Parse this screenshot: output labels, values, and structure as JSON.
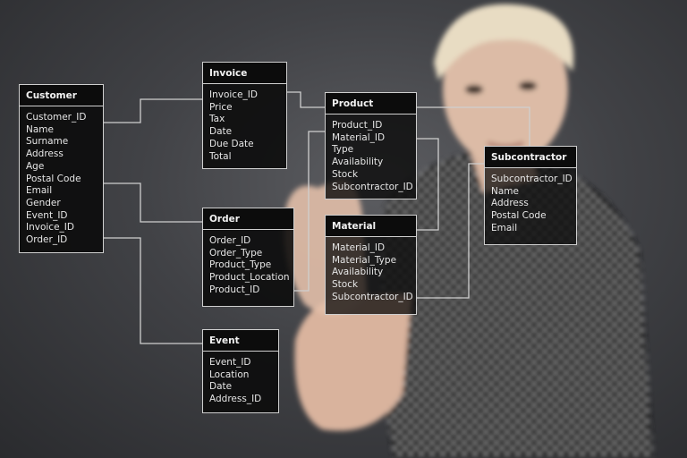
{
  "tables": [
    {
      "key": "customer",
      "title": "Customer",
      "fields": [
        "Customer_ID",
        "Name",
        "Surname",
        "Address",
        "Age",
        "Postal Code",
        "Email",
        "Gender",
        "Event_ID",
        "Invoice_ID",
        "Order_ID"
      ]
    },
    {
      "key": "invoice",
      "title": "Invoice",
      "fields": [
        "Invoice_ID",
        "Price",
        "Tax",
        "Date",
        "Due Date",
        "Total"
      ]
    },
    {
      "key": "order",
      "title": "Order",
      "fields": [
        "Order_ID",
        "Order_Type",
        "Product_Type",
        "Product_Location",
        "Product_ID"
      ]
    },
    {
      "key": "event",
      "title": "Event",
      "fields": [
        "Event_ID",
        "Location",
        "Date",
        "Address_ID"
      ]
    },
    {
      "key": "product",
      "title": "Product",
      "fields": [
        "Product_ID",
        "Material_ID",
        "Type",
        "Availability",
        "Stock",
        "Subcontractor_ID"
      ]
    },
    {
      "key": "material",
      "title": "Material",
      "fields": [
        "Material_ID",
        "Material_Type",
        "Availability",
        "Stock",
        "Subcontractor_ID"
      ]
    },
    {
      "key": "subcontractor",
      "title": "Subcontractor",
      "fields": [
        "Subcontractor_ID",
        "Name",
        "Address",
        "Postal Code",
        "Email"
      ]
    }
  ],
  "colors": {
    "line": "#cfcfcf",
    "box": "#0a0a0a",
    "background": "#434448"
  }
}
